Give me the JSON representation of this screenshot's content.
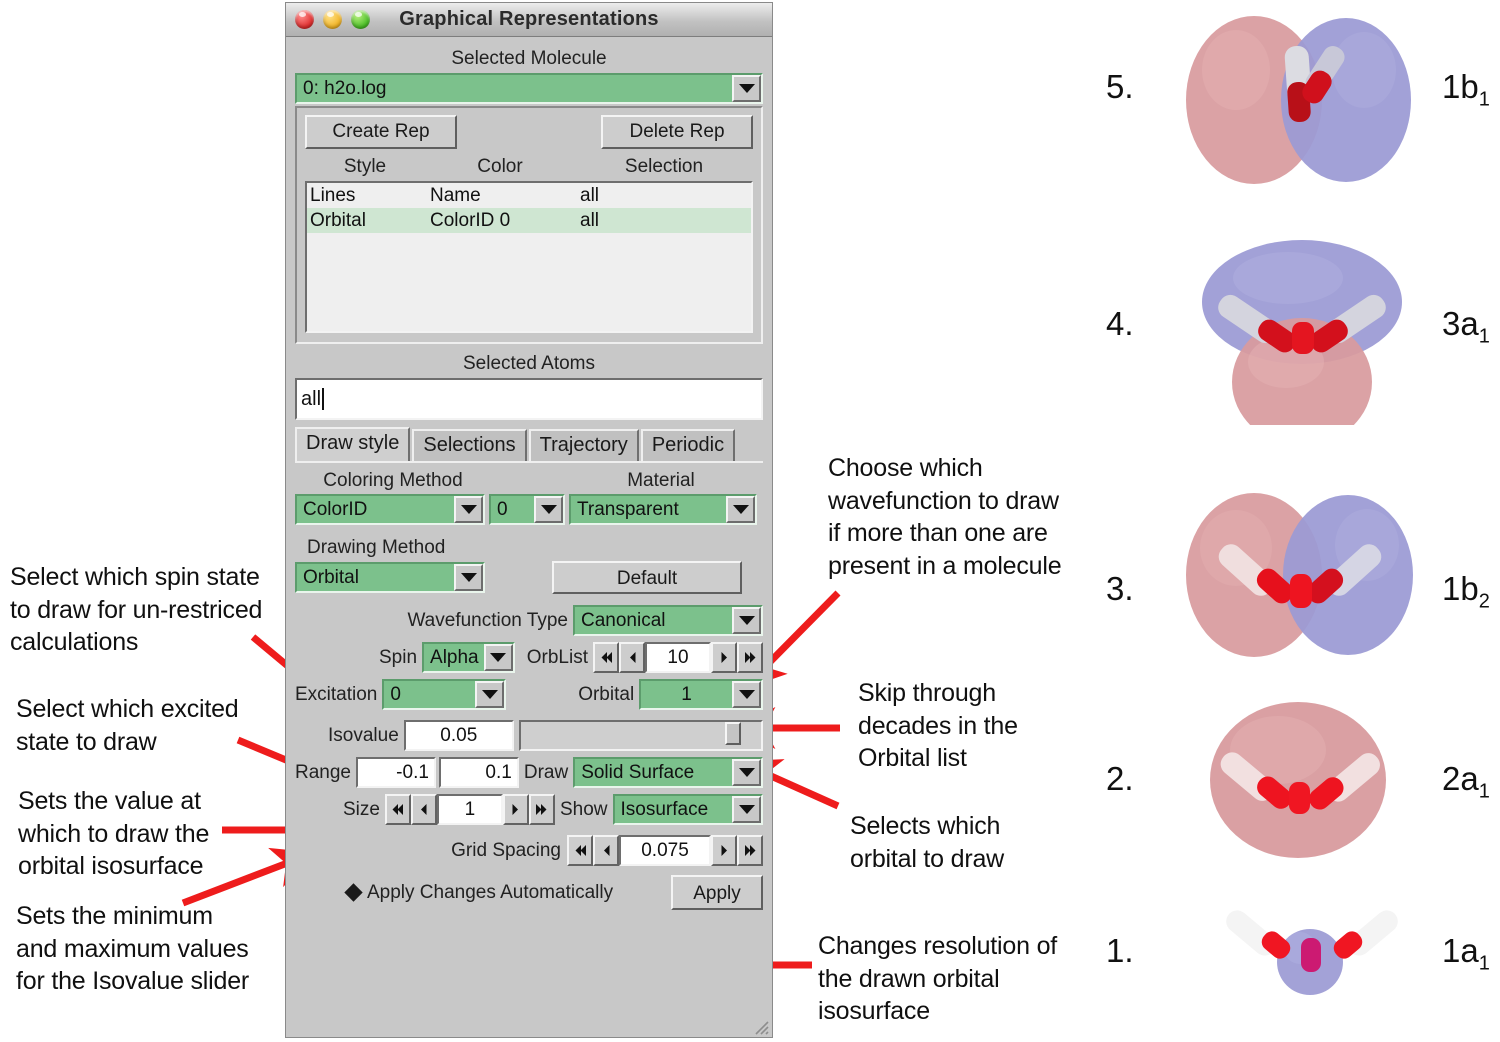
{
  "window": {
    "title": "Graphical Representations",
    "controls": [
      "close",
      "minimize",
      "zoom"
    ],
    "selected_molecule_label": "Selected Molecule",
    "selected_molecule_value": "0: h2o.log",
    "create_rep_label": "Create Rep",
    "delete_rep_label": "Delete Rep",
    "rep_table": {
      "columns": [
        "Style",
        "Color",
        "Selection"
      ],
      "rows": [
        {
          "style": "Lines",
          "color": "Name",
          "selection": "all",
          "selected": false
        },
        {
          "style": "Orbital",
          "color": "ColorID 0",
          "selection": "all",
          "selected": true
        }
      ]
    },
    "selected_atoms_label": "Selected Atoms",
    "selected_atoms_value": "all",
    "tabs": [
      {
        "label": "Draw style",
        "active": true
      },
      {
        "label": "Selections",
        "active": false
      },
      {
        "label": "Trajectory",
        "active": false
      },
      {
        "label": "Periodic",
        "active": false
      }
    ],
    "coloring_method_label": "Coloring Method",
    "coloring_method_value": "ColorID",
    "color_id_value": "0",
    "material_label": "Material",
    "material_value": "Transparent",
    "drawing_method_label": "Drawing Method",
    "drawing_method_value": "Orbital",
    "default_button_label": "Default",
    "wavefunction_type_label": "Wavefunction Type",
    "wavefunction_type_value": "Canonical",
    "spin_label": "Spin",
    "spin_value": "Alpha",
    "orblist_label": "OrbList",
    "orblist_value": "10",
    "excitation_label": "Excitation",
    "excitation_value": "0",
    "orbital_label": "Orbital",
    "orbital_value": "1",
    "isovalue_label": "Isovalue",
    "isovalue_value": "0.05",
    "isovalue_slider_percent": 85,
    "range_label": "Range",
    "range_min": "-0.1",
    "range_max": "0.1",
    "draw_label": "Draw",
    "draw_value": "Solid Surface",
    "size_label": "Size",
    "size_value": "1",
    "show_label": "Show",
    "show_value": "Isosurface",
    "grid_spacing_label": "Grid Spacing",
    "grid_spacing_value": "0.075",
    "apply_auto_label": "Apply Changes Automatically",
    "apply_button_label": "Apply",
    "accent_green": "#7cc18c",
    "panel_gray": "#c8c8c8"
  },
  "annotations": {
    "left": [
      {
        "id": "spin-note",
        "text": "Select which spin state to draw for un-restriced calculations"
      },
      {
        "id": "excitation-note",
        "text": "Select which excited state to draw"
      },
      {
        "id": "isovalue-note",
        "text": "Sets the value at which to draw the orbital isosurface"
      },
      {
        "id": "range-note",
        "text": "Sets the minimum and maximum values for the Isovalue slider"
      }
    ],
    "right": [
      {
        "id": "wavefunction-note",
        "text": "Choose which wavefunction to draw if more than one are present in a molecule"
      },
      {
        "id": "orblist-note",
        "text": "Skip through decades in the Orbital list"
      },
      {
        "id": "orbital-note",
        "text": "Selects which orbital to draw"
      },
      {
        "id": "gridspacing-note",
        "text": "Changes resolution of the drawn orbital isosurface"
      }
    ],
    "arrow_color": "#ee1c1c"
  },
  "orbitals": [
    {
      "number": "5.",
      "label": "1b",
      "sub": "1",
      "kind": "two-lobe-horizontal"
    },
    {
      "number": "4.",
      "label": "3a",
      "sub": "1",
      "kind": "blue-top-red-bottom"
    },
    {
      "number": "3.",
      "label": "1b",
      "sub": "2",
      "kind": "two-lobe-horizontal-large"
    },
    {
      "number": "2.",
      "label": "2a",
      "sub": "1",
      "kind": "single-red-blob"
    },
    {
      "number": "1.",
      "label": "1a",
      "sub": "1",
      "kind": "small-blue-core"
    }
  ],
  "orbital_colors": {
    "positive_lobe": "#d79a9c",
    "negative_lobe": "#9a9ad2",
    "oxygen": "#e01520",
    "hydrogen": "#e8e8ec"
  }
}
